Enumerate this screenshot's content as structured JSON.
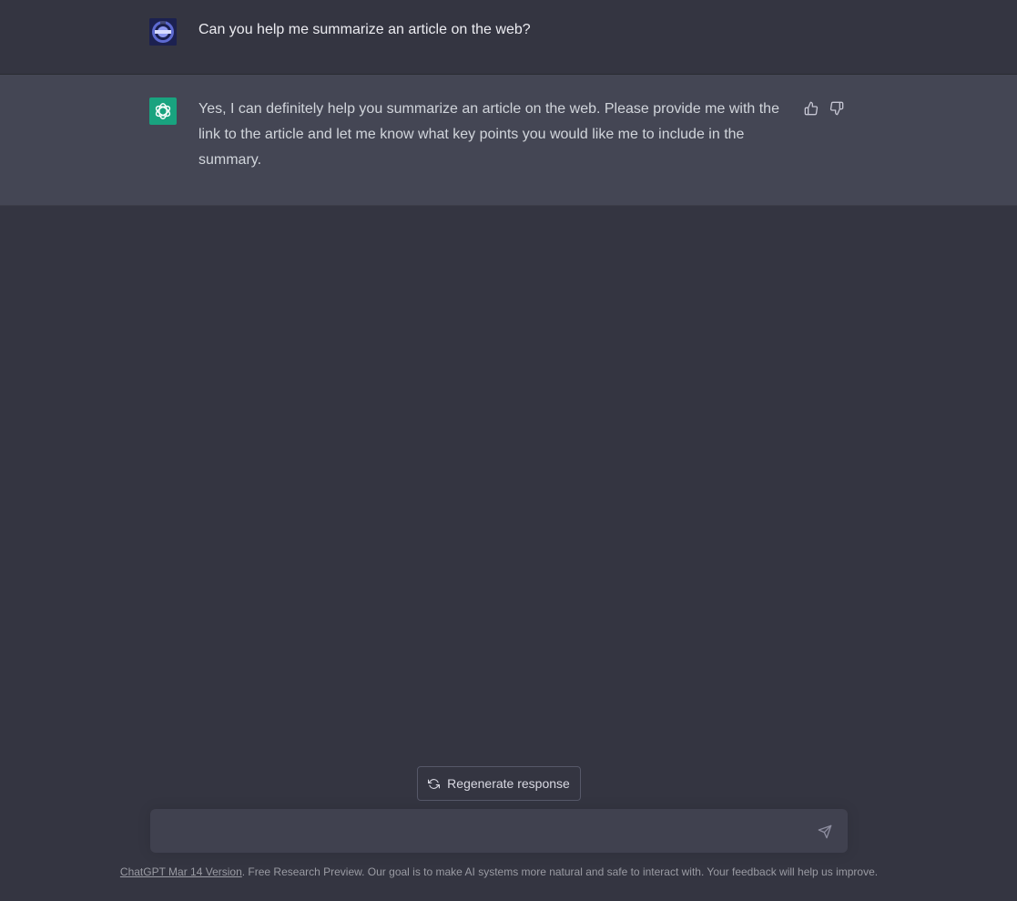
{
  "conversation": {
    "user_message": "Can you help me summarize an article on the web?",
    "assistant_message": "Yes, I can definitely help you summarize an article on the web. Please provide me with the link to the article and let me know what key points you would like me to include in the summary."
  },
  "actions": {
    "regenerate_label": "Regenerate response"
  },
  "input": {
    "value": "",
    "placeholder": ""
  },
  "footer": {
    "version_link": "ChatGPT Mar 14 Version",
    "text": ". Free Research Preview. Our goal is to make AI systems more natural and safe to interact with. Your feedback will help us improve."
  },
  "icons": {
    "user_avatar": "user-avatar-image",
    "assistant_avatar": "openai-logo-icon",
    "thumbs_up": "thumbs-up-icon",
    "thumbs_down": "thumbs-down-icon",
    "regenerate": "refresh-icon",
    "send": "send-icon"
  },
  "colors": {
    "background": "#343541",
    "assistant_row": "#444654",
    "input_bg": "#40414f",
    "assistant_avatar_bg": "#19a37f"
  }
}
